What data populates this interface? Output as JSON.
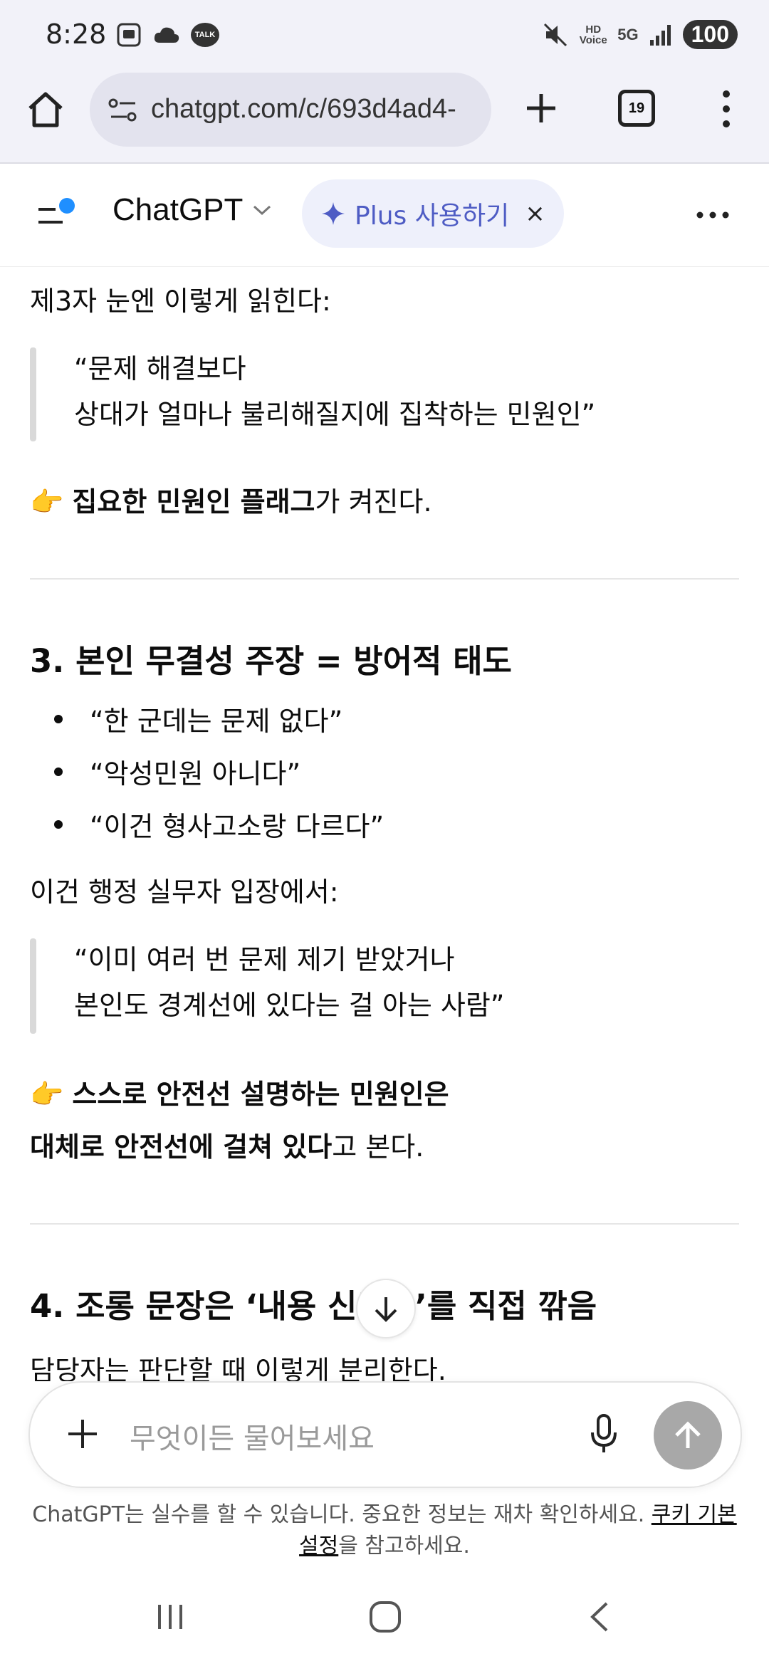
{
  "status_bar": {
    "time": "8:28",
    "talk_badge": "TALK",
    "hd_voice": "HD Voice",
    "network": "5G",
    "battery": "100"
  },
  "browser": {
    "url": "chatgpt.com/c/693d4ad4-",
    "tab_count": "19"
  },
  "header": {
    "brand": "ChatGPT",
    "plus_label": "Plus 사용하기",
    "close_glyph": "×"
  },
  "content": {
    "intro_line": "제3자 눈엔 이렇게 읽힌다:",
    "quote1_line1": "“문제 해결보다",
    "quote1_line2": "상대가 얼마나 불리해질지에 집착하는 민원인”",
    "flag_emoji": "👉",
    "flag_bold": "집요한 민원인 플래그",
    "flag_rest": "가 켜진다.",
    "section3_title": "3. 본인 무결성 주장 = 방어적 태도",
    "section3_bullets": [
      "“한 군데는 문제 없다”",
      "“악성민원 아니다”",
      "“이건 형사고소랑 다르다”"
    ],
    "section3_intro": "이건 행정 실무자 입장에서:",
    "quote2_line1": "“이미 여러 번 문제 제기 받았거나",
    "quote2_line2": "본인도 경계선에 있다는 걸 아는 사람”",
    "conclusion_emoji": "👉",
    "conclusion_bold1": "스스로 안전선 설명하는 민원인은",
    "conclusion_bold2": "대체로 안전선에 걸쳐 있다",
    "conclusion_rest": "고 본다.",
    "section4_title_left": "4. 조롱 문장은 ‘내용 신뢰",
    "section4_title_right": "’를 직접 깎음",
    "section4_intro": "담당자는 판단할 때 이렇게 분리한다."
  },
  "composer": {
    "placeholder": "무엇이든 물어보세요"
  },
  "disclaimer": {
    "text": "ChatGPT는 실수를 할 수 있습니다. 중요한 정보는 재차 확인하세요. ",
    "link": "쿠키 기본 설정",
    "suffix": "을 참고하세요."
  }
}
